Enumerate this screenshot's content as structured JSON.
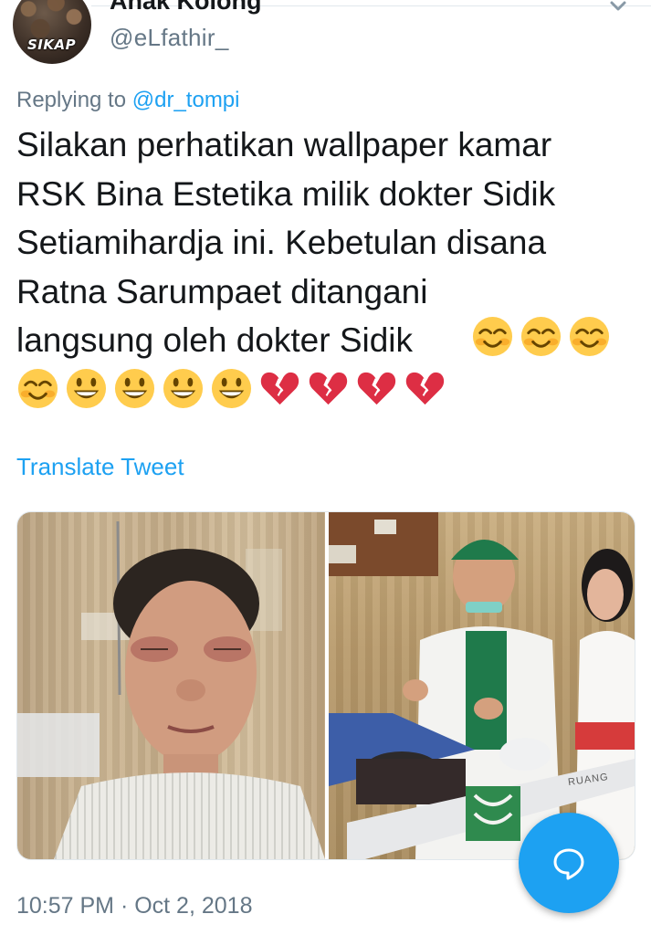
{
  "header": {
    "display_name": "Anak Kolong",
    "handle": "@eLfathir_",
    "avatar_badge": "SIKAP",
    "menu_icon": "chevron-down-icon"
  },
  "reply": {
    "prefix": "Replying to",
    "mention": "@dr_tompi"
  },
  "tweet": {
    "text": "Silakan perhatikan wallpaper kamar\nRSK Bina Estetika milik dokter Sidik\nSetiamihardja ini.  Kebetulan disana\nRatna Sarumpaet ditangani\nlangsung oleh dokter Sidik",
    "emoji_row1": [
      "smiling-face-icon",
      "smiling-face-icon",
      "smiling-face-icon"
    ],
    "emoji_row2": [
      "smiling-face-icon",
      "grinning-face-icon",
      "grinning-face-icon",
      "grinning-face-icon",
      "grinning-face-icon",
      "broken-heart-icon",
      "broken-heart-icon",
      "broken-heart-icon",
      "broken-heart-icon"
    ]
  },
  "translate_label": "Translate Tweet",
  "media": {
    "ward_sign": "RUANG"
  },
  "timestamp": "10:57 PM · Oct 2, 2018",
  "compose_icon": "compose-bubble-icon",
  "colors": {
    "accent": "#1da1f2",
    "secondary_text": "#657786",
    "primary_text": "#14171a"
  }
}
